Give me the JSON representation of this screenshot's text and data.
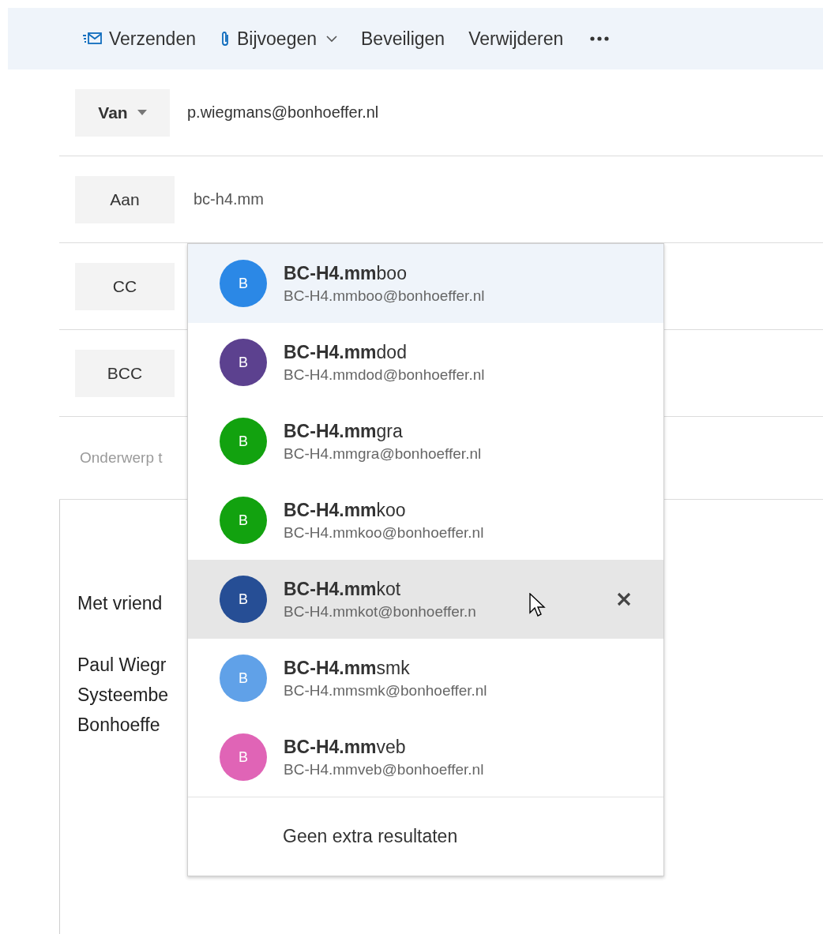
{
  "toolbar": [
    {
      "kind": "send",
      "label": "Verzenden"
    },
    {
      "kind": "attach",
      "label": "Bijvoegen"
    },
    {
      "kind": "plain",
      "label": "Beveiligen"
    },
    {
      "kind": "plain",
      "label": "Verwijderen"
    },
    {
      "kind": "more"
    }
  ],
  "from": {
    "label": "Van",
    "value": "p.wiegmans@bonhoeffer.nl"
  },
  "recipients": [
    {
      "label": "Aan",
      "value": "bc-h4.mm"
    },
    {
      "label": "CC"
    },
    {
      "label": "BCC"
    }
  ],
  "subject": {
    "placeholder": "Onderwerp t"
  },
  "body": {
    "paragraphs": [
      [
        "Met vriend"
      ],
      [
        "Paul Wiegr",
        "Systeembe",
        "Bonhoeffe"
      ]
    ]
  },
  "suggestions": {
    "items": [
      {
        "initial": "B",
        "color": "#2b88e6",
        "name": "**BC-H4.mm**boo",
        "email": "BC-H4.mmboo@bonhoeffer.nl",
        "selected": true,
        "hover": false
      },
      {
        "initial": "B",
        "color": "#5c418f",
        "name": "**BC-H4.mm**dod",
        "email": "BC-H4.mmdod@bonhoeffer.nl",
        "selected": false,
        "hover": false
      },
      {
        "initial": "B",
        "color": "#12a20f",
        "name": "**BC-H4.mm**gra",
        "email": "BC-H4.mmgra@bonhoeffer.nl",
        "selected": false,
        "hover": false
      },
      {
        "initial": "B",
        "color": "#12a20f",
        "name": "**BC-H4.mm**koo",
        "email": "BC-H4.mmkoo@bonhoeffer.nl",
        "selected": false,
        "hover": false
      },
      {
        "initial": "B",
        "color": "#264e95",
        "name": "**BC-H4.mm**kot",
        "email": "BC-H4.mmkot@bonhoeffer.n",
        "selected": false,
        "hover": true
      },
      {
        "initial": "B",
        "color": "#60a1e8",
        "name": "**BC-H4.mm**smk",
        "email": "BC-H4.mmsmk@bonhoeffer.nl",
        "selected": false,
        "hover": false
      },
      {
        "initial": "B",
        "color": "#e064b6",
        "name": "**BC-H4.mm**veb",
        "email": "BC-H4.mmveb@bonhoeffer.nl",
        "selected": false,
        "hover": false
      }
    ],
    "footer": "Geen extra resultaten"
  }
}
